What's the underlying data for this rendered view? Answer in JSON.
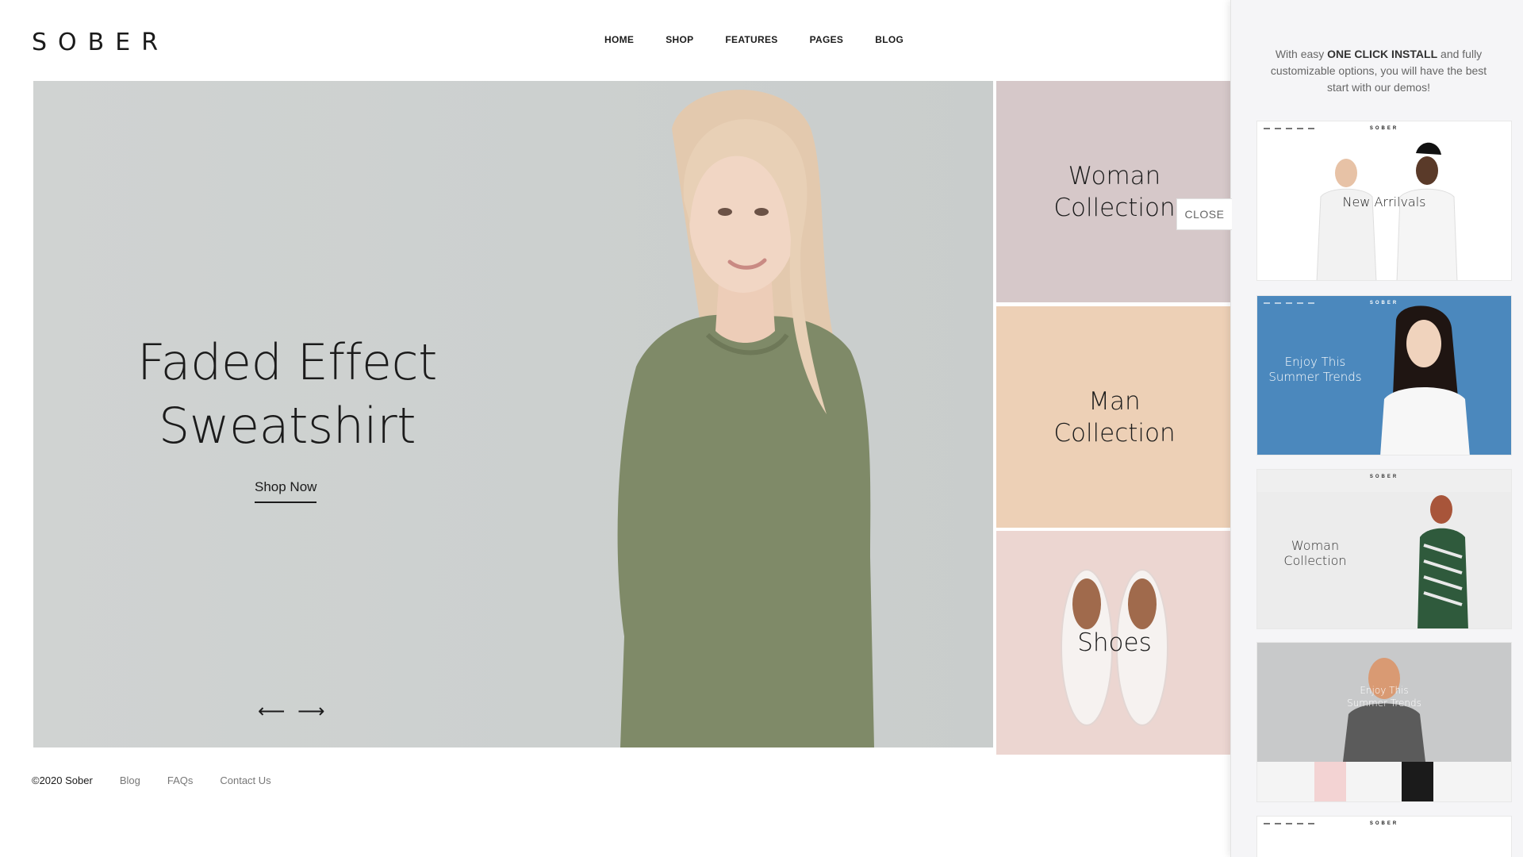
{
  "brand": {
    "logo": "SOBER"
  },
  "nav": {
    "items": [
      "HOME",
      "SHOP",
      "FEATURES",
      "PAGES",
      "BLOG"
    ]
  },
  "hero": {
    "title_line1": "Faded Effect",
    "title_line2": "Sweatshirt",
    "cta": "Shop Now",
    "prev_icon": "arrow-left-icon",
    "next_icon": "arrow-right-icon",
    "prev_glyph": "⟵",
    "next_glyph": "⟶"
  },
  "tiles": [
    {
      "line1": "Woman",
      "line2": "Collection"
    },
    {
      "line1": "Man",
      "line2": "Collection"
    },
    {
      "line1": "Shoes",
      "line2": ""
    }
  ],
  "footer": {
    "copyright": "©2020 Sober",
    "links": [
      "Blog",
      "FAQs",
      "Contact Us"
    ]
  },
  "panel": {
    "intro_before": "With easy ",
    "intro_bold": "ONE CLICK INSTALL",
    "intro_after": " and fully customizable options, you will have the best start with our demos!",
    "close_label": "CLOSE",
    "demos": [
      {
        "title": "New Arrilvals",
        "logo": "SOBER"
      },
      {
        "title_line1": "Enjoy This",
        "title_line2": "Summer Trends",
        "logo": "SOBER"
      },
      {
        "title_line1": "Woman",
        "title_line2": "Collection",
        "logo": "SOBER"
      },
      {
        "title_line1": "Enjoy This",
        "title_line2": "Summer Trends"
      },
      {
        "logo": "SOBER"
      }
    ]
  },
  "colors": {
    "hero_bg": "#cfd2d1",
    "woman_tile": "#d6c8c9",
    "man_tile": "#edd0b6",
    "shoes_tile": "#ecd6d1",
    "panel_bg": "#f5f5f7",
    "demo_blue": "#4b88bd"
  }
}
